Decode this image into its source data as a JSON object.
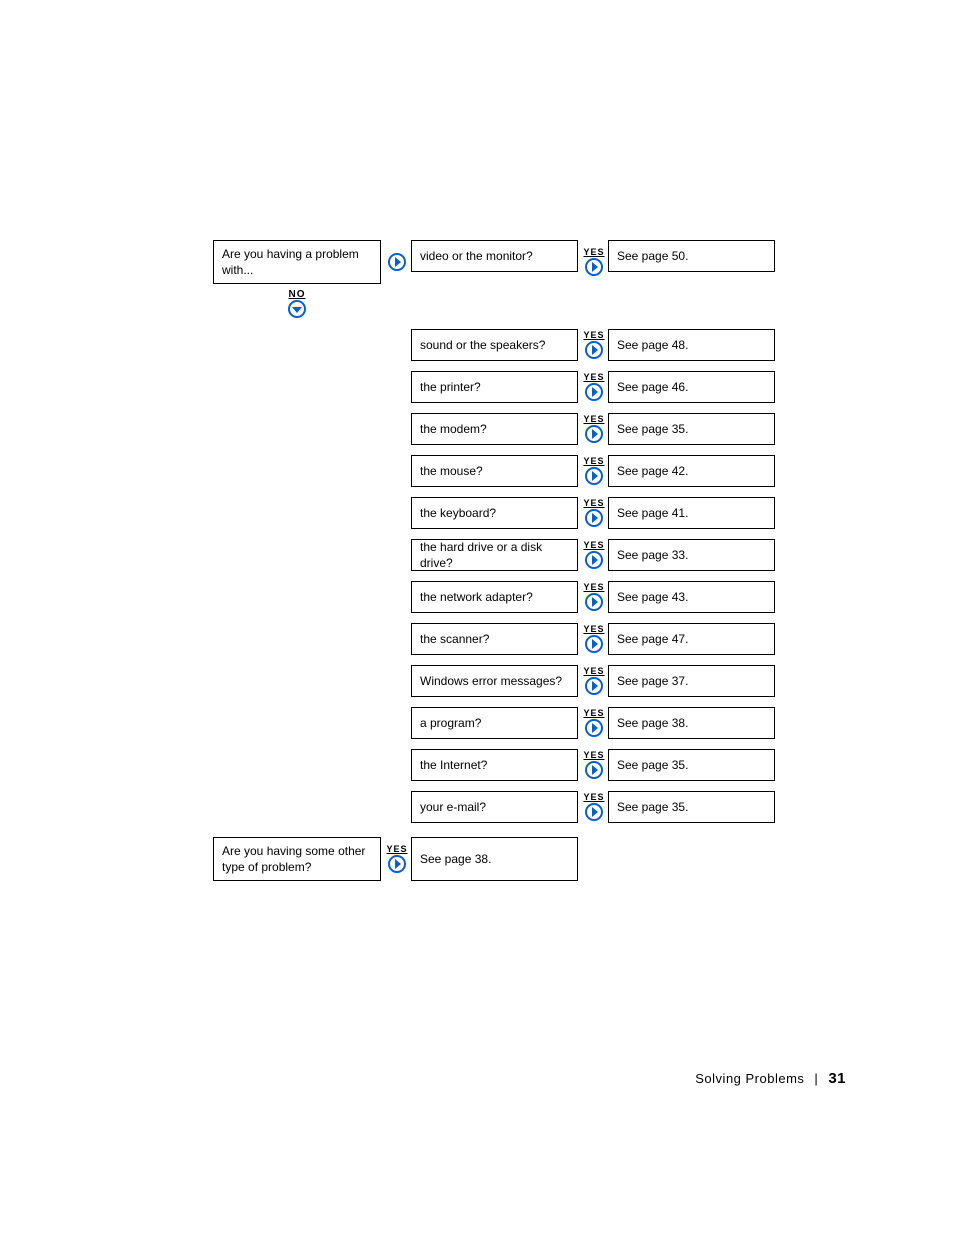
{
  "labels": {
    "yes": "YES",
    "no": "NO"
  },
  "question1": "Are you having a problem with...",
  "question2": "Are you having some other type of problem?",
  "question2_answer": "See page 38.",
  "items": [
    {
      "problem": "video or the monitor?",
      "answer": "See page 50."
    },
    {
      "problem": "sound or the speakers?",
      "answer": "See page 48."
    },
    {
      "problem": "the printer?",
      "answer": "See page 46."
    },
    {
      "problem": "the modem?",
      "answer": "See page 35."
    },
    {
      "problem": "the mouse?",
      "answer": "See page 42."
    },
    {
      "problem": "the keyboard?",
      "answer": "See page 41."
    },
    {
      "problem": "the hard drive or a disk drive?",
      "answer": "See page 33."
    },
    {
      "problem": "the network adapter?",
      "answer": "See page 43."
    },
    {
      "problem": "the scanner?",
      "answer": "See page 47."
    },
    {
      "problem": "Windows error messages?",
      "answer": "See page 37."
    },
    {
      "problem": "a program?",
      "answer": "See page 38."
    },
    {
      "problem": "the Internet?",
      "answer": "See page 35."
    },
    {
      "problem": "your e-mail?",
      "answer": "See page 35."
    }
  ],
  "footer": {
    "section": "Solving Problems",
    "separator": "|",
    "page": "31"
  },
  "colors": {
    "arrow_blue": "#0a5ec7"
  }
}
